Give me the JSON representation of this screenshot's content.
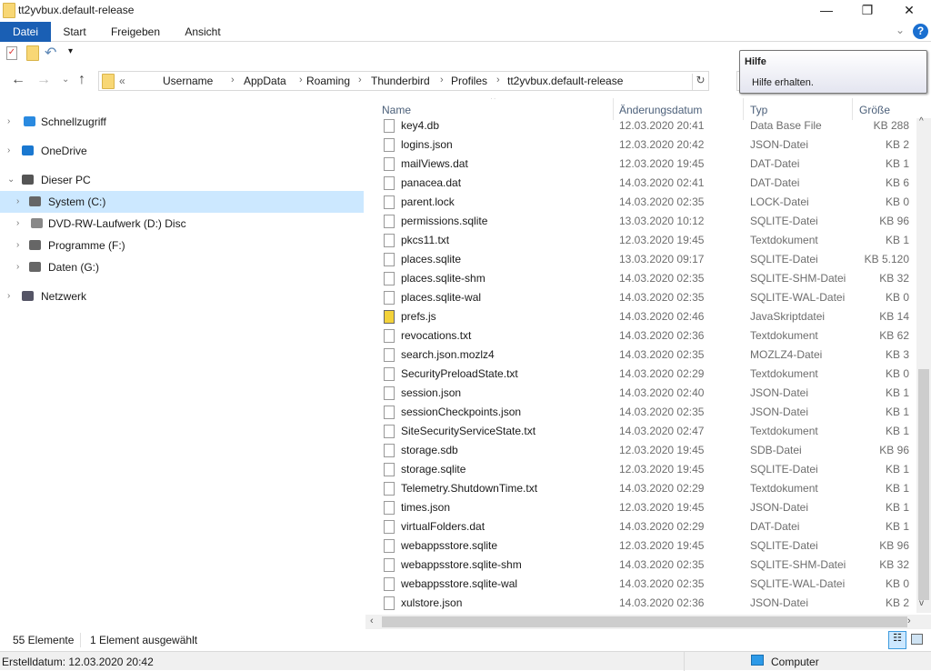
{
  "window": {
    "title": "tt2yvbux.default-release",
    "minimize": "—",
    "maximize": "❐",
    "close": "✕"
  },
  "ribbon": {
    "tabs": [
      "Datei",
      "Start",
      "Freigeben",
      "Ansicht"
    ],
    "help": "?",
    "expand": "⌄"
  },
  "address": {
    "overflow": "«",
    "crumbs": [
      "Username",
      "AppData",
      "Roaming",
      "Thunderbird",
      "Profiles",
      "tt2yvbux.default-release"
    ],
    "refresh": "↻"
  },
  "tooltip": {
    "title": "Hilfe",
    "text": "Hilfe erhalten."
  },
  "nav": {
    "items": [
      {
        "label": "Schnellzugriff",
        "icon": "star-icon"
      },
      {
        "label": "OneDrive",
        "icon": "cloud-icon"
      },
      {
        "label": "Dieser PC",
        "icon": "computer-icon"
      },
      {
        "label": "System (C:)",
        "icon": "drive-icon"
      },
      {
        "label": "DVD-RW-Laufwerk (D:) Disc",
        "icon": "dvd-icon"
      },
      {
        "label": "Programme (F:)",
        "icon": "drive-icon"
      },
      {
        "label": "Daten (G:)",
        "icon": "drive-icon"
      },
      {
        "label": "Netzwerk",
        "icon": "network-icon"
      }
    ]
  },
  "columns": {
    "name": "Name",
    "date": "Änderungsdatum",
    "type": "Typ",
    "size": "Größe"
  },
  "files": [
    [
      "key4.db",
      "12.03.2020 20:41",
      "Data Base File",
      "288 KB"
    ],
    [
      "logins.json",
      "12.03.2020 20:42",
      "JSON-Datei",
      "2 KB"
    ],
    [
      "mailViews.dat",
      "12.03.2020 19:45",
      "DAT-Datei",
      "1 KB"
    ],
    [
      "panacea.dat",
      "14.03.2020 02:41",
      "DAT-Datei",
      "6 KB"
    ],
    [
      "parent.lock",
      "14.03.2020 02:35",
      "LOCK-Datei",
      "0 KB"
    ],
    [
      "permissions.sqlite",
      "13.03.2020 10:12",
      "SQLITE-Datei",
      "96 KB"
    ],
    [
      "pkcs11.txt",
      "12.03.2020 19:45",
      "Textdokument",
      "1 KB"
    ],
    [
      "places.sqlite",
      "13.03.2020 09:17",
      "SQLITE-Datei",
      "5.120 KB"
    ],
    [
      "places.sqlite-shm",
      "14.03.2020 02:35",
      "SQLITE-SHM-Datei",
      "32 KB"
    ],
    [
      "places.sqlite-wal",
      "14.03.2020 02:35",
      "SQLITE-WAL-Datei",
      "0 KB"
    ],
    [
      "prefs.js",
      "14.03.2020 02:46",
      "JavaSkriptdatei",
      "14 KB"
    ],
    [
      "revocations.txt",
      "14.03.2020 02:36",
      "Textdokument",
      "62 KB"
    ],
    [
      "search.json.mozlz4",
      "14.03.2020 02:35",
      "MOZLZ4-Datei",
      "3 KB"
    ],
    [
      "SecurityPreloadState.txt",
      "14.03.2020 02:29",
      "Textdokument",
      "0 KB"
    ],
    [
      "session.json",
      "14.03.2020 02:40",
      "JSON-Datei",
      "1 KB"
    ],
    [
      "sessionCheckpoints.json",
      "14.03.2020 02:35",
      "JSON-Datei",
      "1 KB"
    ],
    [
      "SiteSecurityServiceState.txt",
      "14.03.2020 02:47",
      "Textdokument",
      "1 KB"
    ],
    [
      "storage.sdb",
      "12.03.2020 19:45",
      "SDB-Datei",
      "96 KB"
    ],
    [
      "storage.sqlite",
      "12.03.2020 19:45",
      "SQLITE-Datei",
      "1 KB"
    ],
    [
      "Telemetry.ShutdownTime.txt",
      "14.03.2020 02:29",
      "Textdokument",
      "1 KB"
    ],
    [
      "times.json",
      "12.03.2020 19:45",
      "JSON-Datei",
      "1 KB"
    ],
    [
      "virtualFolders.dat",
      "14.03.2020 02:29",
      "DAT-Datei",
      "1 KB"
    ],
    [
      "webappsstore.sqlite",
      "12.03.2020 19:45",
      "SQLITE-Datei",
      "96 KB"
    ],
    [
      "webappsstore.sqlite-shm",
      "14.03.2020 02:35",
      "SQLITE-SHM-Datei",
      "32 KB"
    ],
    [
      "webappsstore.sqlite-wal",
      "14.03.2020 02:35",
      "SQLITE-WAL-Datei",
      "0 KB"
    ],
    [
      "xulstore.json",
      "14.03.2020 02:36",
      "JSON-Datei",
      "2 KB"
    ]
  ],
  "status": {
    "count": "55 Elemente",
    "selected": "1 Element ausgewählt"
  },
  "details": {
    "created": "Erstelldatum: 12.03.2020 20:42",
    "location": "Computer"
  }
}
